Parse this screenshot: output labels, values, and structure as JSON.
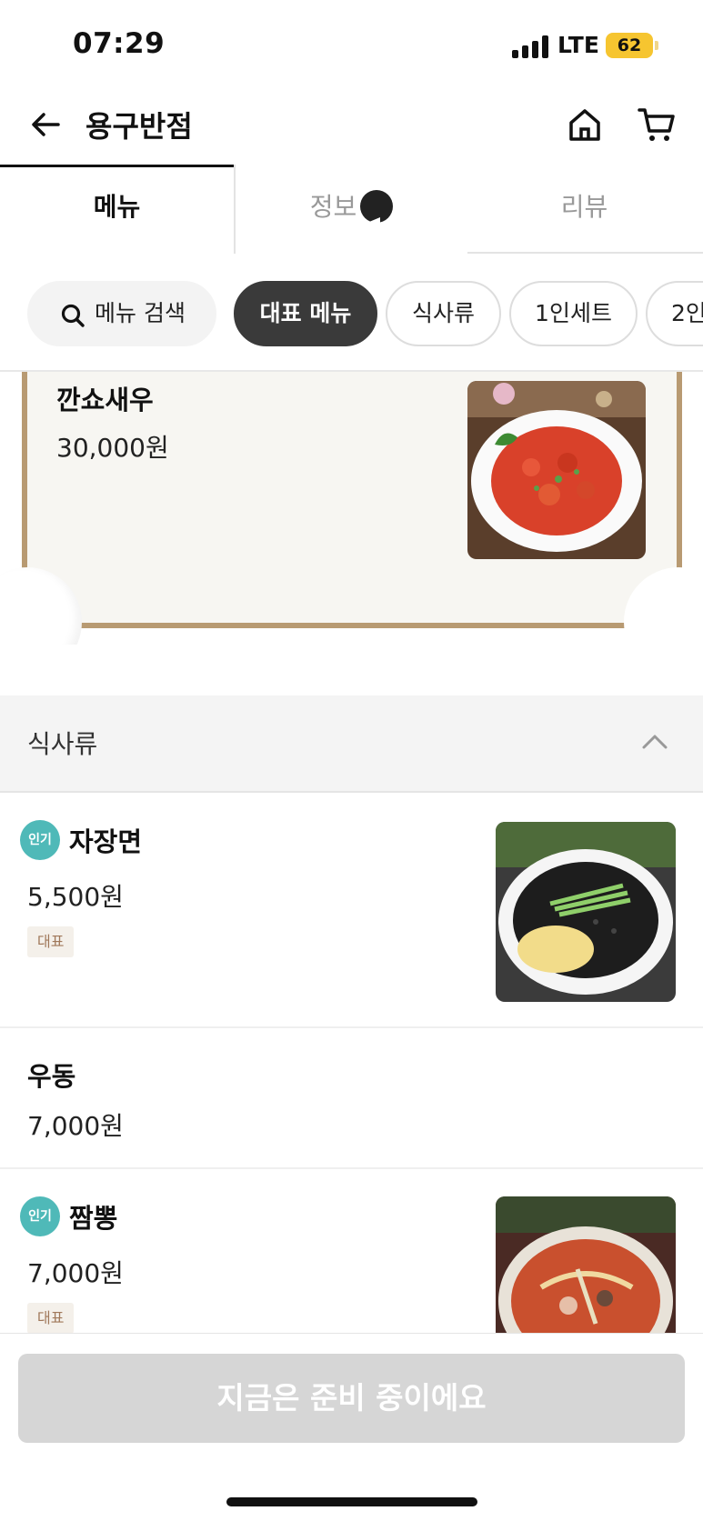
{
  "status_bar": {
    "time": "07:29",
    "network": "LTE",
    "battery": "62"
  },
  "header": {
    "title": "용구반점",
    "icons": [
      "back-arrow-icon",
      "home-icon",
      "cart-icon"
    ]
  },
  "tabs": [
    {
      "label": "메뉴",
      "active": true
    },
    {
      "label": "정보",
      "badge_icon": "megaphone-icon"
    },
    {
      "label": "리뷰"
    }
  ],
  "chips": {
    "search_label": "메뉴 검색",
    "items": [
      "대표 메뉴",
      "식사류",
      "1인세트",
      "2인"
    ]
  },
  "featured": {
    "name": "깐쇼새우",
    "price": "30,000원"
  },
  "category": {
    "label": "식사류"
  },
  "menu_items": [
    {
      "name": "자장면",
      "price": "5,500원",
      "popular_badge": "인기",
      "tag": "대표"
    },
    {
      "name": "우동",
      "price": "7,000원"
    },
    {
      "name": "짬뽕",
      "price": "7,000원",
      "popular_badge": "인기",
      "tag": "대표"
    }
  ],
  "bottom_button": {
    "label": "지금은 준비 중이에요"
  },
  "colors": {
    "accent_teal": "#4fb9b8",
    "frame_gold": "#b89a72",
    "chip_active": "#3a3a3a",
    "disabled_button": "#d6d6d6"
  }
}
